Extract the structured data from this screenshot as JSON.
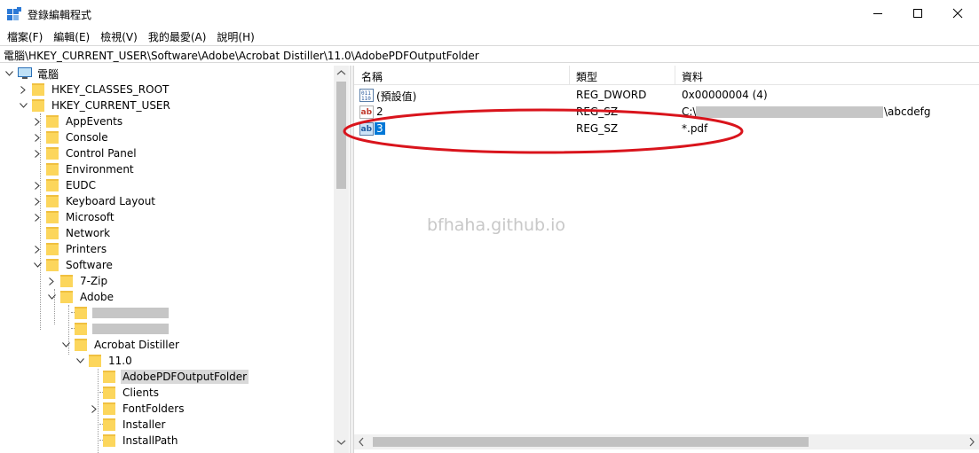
{
  "window": {
    "title": "登錄編輯程式",
    "controls": {
      "minimize": "minimize",
      "maximize": "maximize",
      "close": "close"
    }
  },
  "menu": [
    "檔案(F)",
    "編輯(E)",
    "檢視(V)",
    "我的最愛(A)",
    "說明(H)"
  ],
  "address": "電腦\\HKEY_CURRENT_USER\\Software\\Adobe\\Acrobat Distiller\\11.0\\AdobePDFOutputFolder",
  "tree": {
    "root": "電腦",
    "hkcr": "HKEY_CLASSES_ROOT",
    "hkcu": "HKEY_CURRENT_USER",
    "appevents": "AppEvents",
    "console": "Console",
    "control_panel": "Control Panel",
    "environment": "Environment",
    "eudc": "EUDC",
    "keyboard_layout": "Keyboard Layout",
    "microsoft": "Microsoft",
    "network": "Network",
    "printers": "Printers",
    "software": "Software",
    "zip": "7-Zip",
    "adobe": "Adobe",
    "acrobat_distiller": "Acrobat Distiller",
    "version": "11.0",
    "output_folder": "AdobePDFOutputFolder",
    "clients": "Clients",
    "fontfolders": "FontFolders",
    "installer": "Installer",
    "installpath": "InstallPath"
  },
  "list": {
    "headers": {
      "name": "名稱",
      "type": "類型",
      "data": "資料"
    },
    "rows": [
      {
        "name": "(預設值)",
        "type": "REG_DWORD",
        "data": "0x00000004 (4)",
        "icon": "binary-value-icon"
      },
      {
        "name": "2",
        "type": "REG_SZ",
        "data_prefix": "C:\\",
        "data_suffix": "\\abcdefg",
        "icon": "string-value-icon"
      },
      {
        "name": "3",
        "type": "REG_SZ",
        "data": "*.pdf",
        "icon": "string-value-icon"
      }
    ]
  },
  "watermark": "bfhaha.github.io",
  "colors": {
    "highlight": "#0078d7",
    "annotation": "#d9141c",
    "folder": "#fcd65c"
  }
}
